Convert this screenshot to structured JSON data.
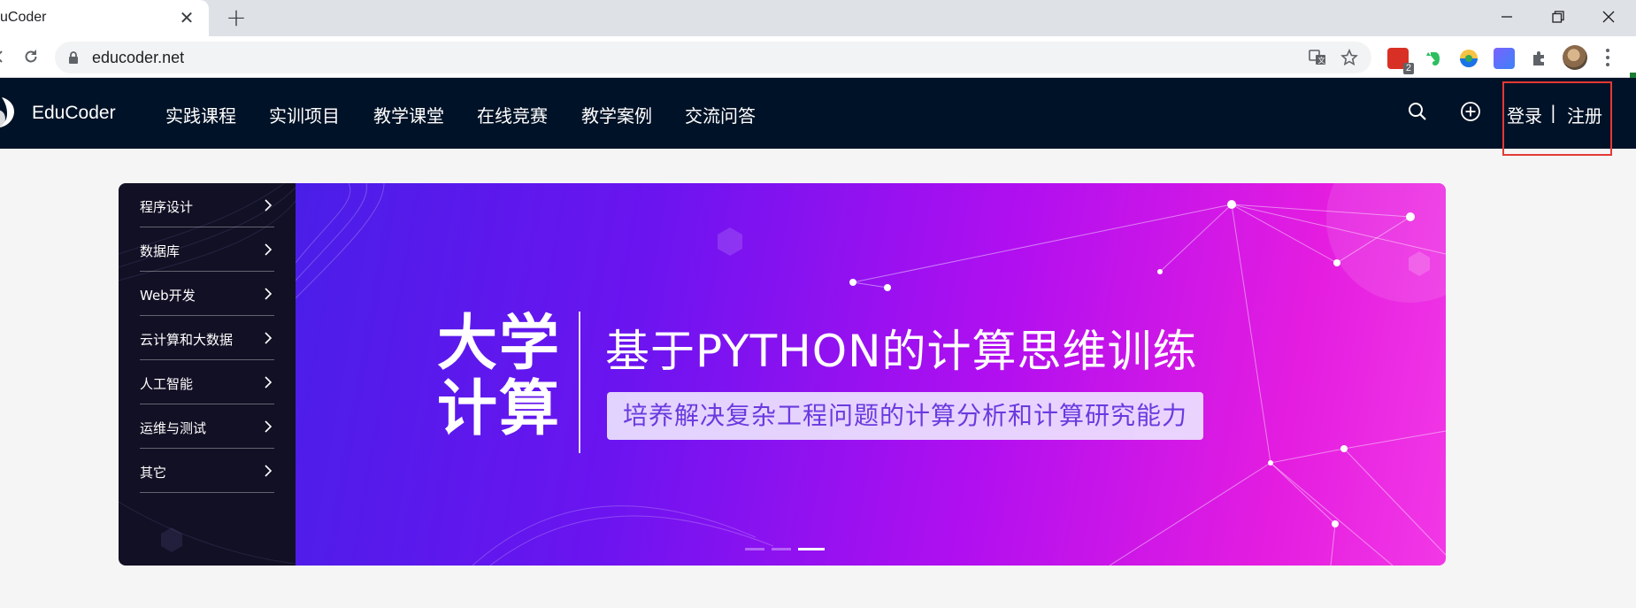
{
  "browser": {
    "tab_title": "uCoder",
    "url": "educoder.net",
    "extension_badge": "2"
  },
  "site": {
    "logo_text": "EduCoder",
    "nav": [
      "实践课程",
      "实训项目",
      "教学课堂",
      "在线竞赛",
      "教学案例",
      "交流问答"
    ],
    "auth": {
      "login": "登录",
      "separator": "|",
      "register": "注册"
    }
  },
  "categories": [
    "程序设计",
    "数据库",
    "Web开发",
    "云计算和大数据",
    "人工智能",
    "运维与测试",
    "其它"
  ],
  "banner": {
    "left_line1": "大学",
    "left_line2": "计算",
    "title": "基于PYTHON的计算思维训练",
    "subtitle": "培养解决复杂工程问题的计算分析和计算研究能力",
    "slide_count": 3,
    "active_slide": 3
  },
  "colors": {
    "header_bg": "#001227",
    "highlight_box": "#e53935"
  }
}
